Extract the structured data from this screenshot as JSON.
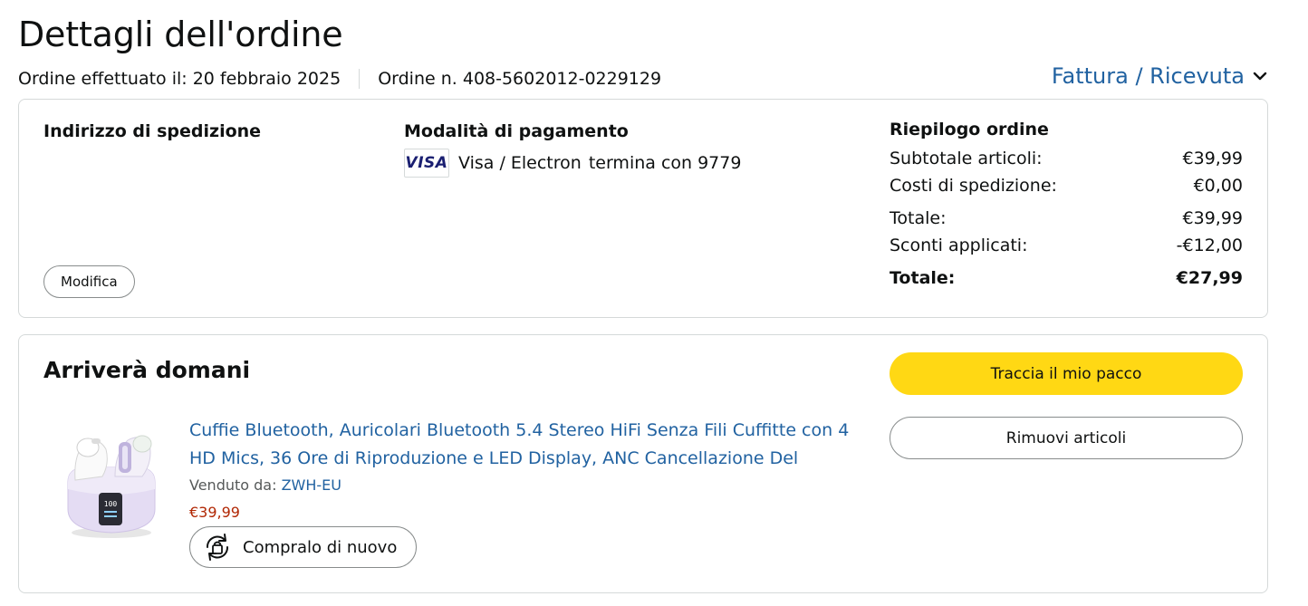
{
  "page": {
    "title": "Dettagli dell'ordine",
    "order_date_label": "Ordine effettuato il: 20 febbraio 2025",
    "order_number_label": "Ordine n. 408-5602012-0229129",
    "invoice_link": "Fattura / Ricevuta"
  },
  "shipping": {
    "heading": "Indirizzo di spedizione",
    "edit_button": "Modifica"
  },
  "payment": {
    "heading": "Modalità di pagamento",
    "card_logo": "VISA",
    "card_type": "Visa / Electron",
    "card_ending": "termina con 9779"
  },
  "summary": {
    "heading": "Riepilogo ordine",
    "rows": [
      {
        "label": "Subtotale articoli:",
        "value": "€39,99"
      },
      {
        "label": "Costi di spedizione:",
        "value": "€0,00"
      },
      {
        "label": "Totale:",
        "value": "€39,99"
      },
      {
        "label": "Sconti applicati:",
        "value": "-€12,00"
      },
      {
        "label": "Totale:",
        "value": "€27,99"
      }
    ]
  },
  "delivery": {
    "heading": "Arriverà domani",
    "track_button": "Traccia il mio pacco",
    "remove_button": "Rimuovi articoli"
  },
  "product": {
    "title": "Cuffie Bluetooth, Auricolari Bluetooth 5.4 Stereo HiFi Senza Fili Cuffitte con 4 HD Mics, 36 Ore di Riproduzione e LED Display, ANC Cancellazione Del",
    "sold_by_label": "Venduto da:",
    "seller": "ZWH-EU",
    "price": "€39,99",
    "buy_again_button": "Compralo di nuovo",
    "case_display": "100"
  },
  "colors": {
    "link": "#2162a1",
    "price": "#b12704",
    "primary_button": "#ffd814",
    "border": "#d5d9d9"
  },
  "icons": [
    "chevron-down-icon",
    "visa-logo",
    "buy-again-icon",
    "product-image"
  ]
}
